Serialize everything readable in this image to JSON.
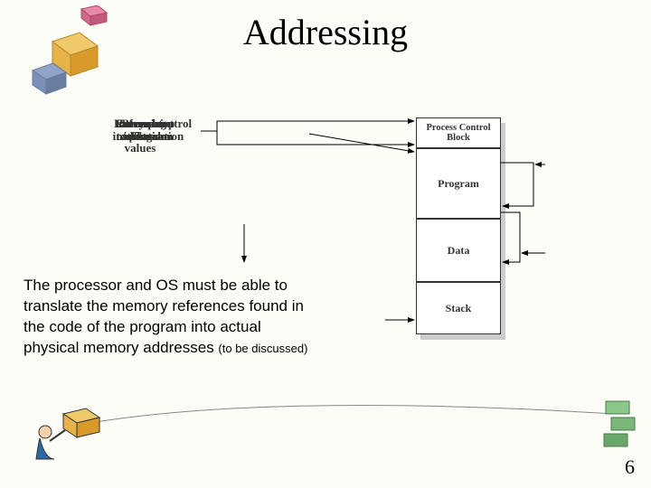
{
  "title": "Addressing",
  "page_number": "6",
  "body_text": "The processor and OS must be able to translate the memory references found in the code of the program into actual physical memory addresses ",
  "body_small": "(to be discussed)",
  "diagram": {
    "labels": {
      "pci": "Process control\ninformation",
      "entry": "Entry point\nto program",
      "increasing": "Increasing\naddress\nvalues",
      "current_top": "Current top\nof stack",
      "branch": "Branch\ninstruction",
      "refdata": "Reference\nto data"
    },
    "blocks": {
      "pcb": "Process Control Block",
      "program": "Program",
      "data": "Data",
      "stack": "Stack"
    }
  }
}
